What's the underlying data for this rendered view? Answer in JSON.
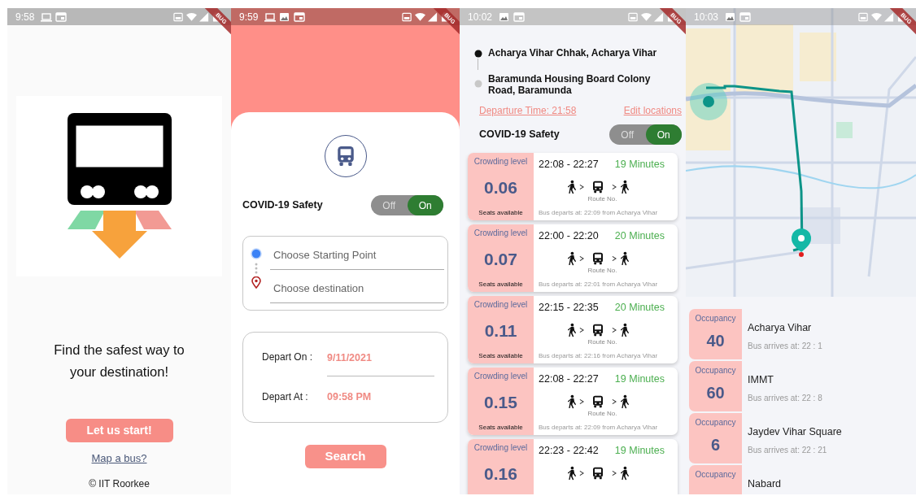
{
  "welcome_screen": {
    "status_time": "9:58",
    "debug_banner": "BUG",
    "tagline": "Find the safest way to your destination!",
    "start_button": "Let us start!",
    "map_link": "Map a bus?",
    "footer": "© IIT Roorkee"
  },
  "search_screen": {
    "status_time": "9:59",
    "debug_banner": "BUG",
    "safety_label": "COVID-19 Safety",
    "safety_toggle": [
      {
        "label": "Off",
        "selected": false
      },
      {
        "label": "On",
        "selected": true
      }
    ],
    "start_field": {
      "placeholder": "Choose Starting Point"
    },
    "destination_field": {
      "placeholder": "Choose destination"
    },
    "depart_on": {
      "label": "Depart On :",
      "value": "9/11/2021"
    },
    "depart_at": {
      "label": "Depart At :",
      "value": "09:58 PM"
    },
    "search_button": "Search"
  },
  "results_screen": {
    "status_time": "10:02",
    "debug_banner": "BUG",
    "stops": [
      {
        "kind": "origin",
        "name": "Acharya Vihar Chhak, Acharya Vihar"
      },
      {
        "kind": "destination",
        "name": "Baramunda Housing Board Colony Road, Baramunda"
      }
    ],
    "departure_link": "Departure Time: 21:58",
    "edit_link": "Edit locations",
    "safety_label": "COVID-19 Safety",
    "safety_toggle": [
      {
        "label": "Off",
        "selected": false
      },
      {
        "label": "On",
        "selected": true
      }
    ],
    "routes": [
      {
        "crowding_label": "Crowding level",
        "crowding": "0.06",
        "seats": "Seats available",
        "time": "22:08 - 22:27",
        "duration": "19 Minutes",
        "route_label": "Route No.",
        "departs": "Bus departs at: 22:09 from Acharya Vihar"
      },
      {
        "crowding_label": "Crowding level",
        "crowding": "0.07",
        "seats": "Seats available",
        "time": "22:00 - 22:20",
        "duration": "20 Minutes",
        "route_label": "Route No.",
        "departs": "Bus departs at: 22:01 from Acharya Vihar"
      },
      {
        "crowding_label": "Crowding level",
        "crowding": "0.11",
        "seats": "Seats available",
        "time": "22:15 - 22:35",
        "duration": "20 Minutes",
        "route_label": "Route No.",
        "departs": "Bus departs at: 22:16 from Acharya Vihar"
      },
      {
        "crowding_label": "Crowding level",
        "crowding": "0.15",
        "seats": "Seats available",
        "time": "22:08 - 22:27",
        "duration": "19 Minutes",
        "route_label": "Route No.",
        "departs": "Bus departs at: 22:09 from Acharya Vihar"
      },
      {
        "crowding_label": "Crowding level",
        "crowding": "0.16",
        "time": "22:23 - 22:42",
        "duration": "19 Minutes"
      }
    ]
  },
  "map_screen": {
    "status_time": "10:03",
    "debug_banner": "BUG",
    "stops": [
      {
        "label": "Occupancy",
        "occupancy": "40",
        "name": "Acharya Vihar",
        "arrival": "Bus arrives at: 22 : 1"
      },
      {
        "label": "Occupancy",
        "occupancy": "60",
        "name": "IMMT",
        "arrival": "Bus arrives at: 22 : 8"
      },
      {
        "label": "Occupancy",
        "occupancy": "6",
        "name": "Jaydev Vihar Square",
        "arrival": "Bus arrives at: 22 : 21"
      },
      {
        "label": "Occupancy",
        "name": "Nabard"
      }
    ]
  }
}
